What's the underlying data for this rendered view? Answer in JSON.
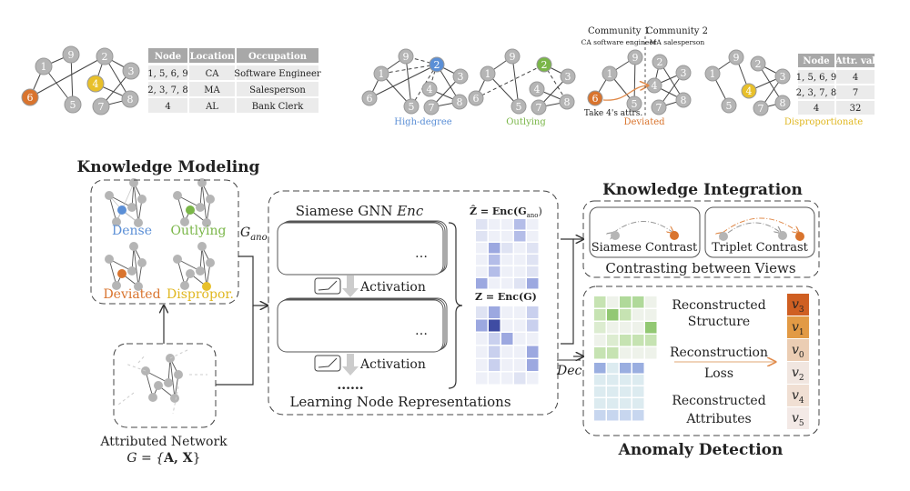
{
  "colors": {
    "gray_node": "#b5b5b5",
    "blue": "#5b8fd6",
    "green": "#7ab648",
    "orange": "#d9742e",
    "yellow": "#e8c02a",
    "purple": "#8f9ae0",
    "table_header": "#a8a8a8",
    "table_cell": "#ebebeb"
  },
  "top_left": {
    "graph_nodes": [
      "1",
      "9",
      "2",
      "3",
      "4",
      "6",
      "5",
      "7",
      "8"
    ],
    "table": {
      "headers": [
        "Node",
        "Location",
        "Occupation"
      ],
      "rows": [
        [
          "1, 5, 6, 9",
          "CA",
          "Software Engineer"
        ],
        [
          "2, 3, 7, 8",
          "MA",
          "Salesperson"
        ],
        [
          "4",
          "AL",
          "Bank Clerk"
        ]
      ]
    }
  },
  "anomaly_types": {
    "high_degree": "High-degree",
    "outlying": "Outlying",
    "deviated": "Deviated",
    "disproportionate": "Disproportionate",
    "community1_title": "Community 1",
    "community1_sub": "CA software engineer",
    "community2_title": "Community 2",
    "community2_sub": "MA salesperson",
    "take_attrs": "Take 4's attrs.",
    "attr_table": {
      "headers": [
        "Node",
        "Attr. val"
      ],
      "rows": [
        [
          "1, 5, 6, 9",
          "4"
        ],
        [
          "2, 3, 7, 8",
          "7"
        ],
        [
          "4",
          "32"
        ]
      ]
    }
  },
  "knowledge_modeling": {
    "title": "Knowledge Modeling",
    "items": [
      "Dense",
      "Outlying",
      "Deviated",
      "Dispropor."
    ],
    "g_ano": "G",
    "g_ano_sub": "ano"
  },
  "attributed_network": {
    "label": "Attributed Network",
    "formula_lhs": "G = {",
    "formula_bold": "A, X",
    "formula_rhs": "}"
  },
  "encoder": {
    "title": "Siamese GNN ",
    "title_math": "Enc",
    "activation": "Activation",
    "ellipsis": "…",
    "more": "......",
    "footer": "Learning Node Representations"
  },
  "embeddings": {
    "z_hat_label": "Ẑ = Enc(G",
    "z_hat_sub": "ano",
    "z_hat_close": ")",
    "z_label": "Z = Enc(G)",
    "z_hat": [
      [
        1,
        0,
        0,
        3,
        0
      ],
      [
        1,
        0,
        0,
        3,
        0
      ],
      [
        0,
        4,
        1,
        0,
        1
      ],
      [
        0,
        3,
        0,
        0,
        1
      ],
      [
        0,
        3,
        0,
        0,
        1
      ],
      [
        4,
        0,
        0,
        1,
        4
      ]
    ],
    "z": [
      [
        1,
        4,
        0,
        0,
        2
      ],
      [
        4,
        8,
        0,
        0,
        2
      ],
      [
        0,
        2,
        4,
        0,
        0
      ],
      [
        0,
        2,
        0,
        0,
        4
      ],
      [
        0,
        2,
        0,
        0,
        4
      ],
      [
        0,
        0,
        0,
        1,
        0
      ]
    ]
  },
  "dec_label": "Dec",
  "knowledge_integration": {
    "title": "Knowledge Integration",
    "siamese": "Siamese Contrast",
    "triplet": "Triplet Contrast",
    "footer": "Contrasting between Views"
  },
  "anomaly_detection": {
    "title": "Anomaly Detection",
    "structure": [
      "Reconstructed",
      "Structure"
    ],
    "loss": [
      "Reconstruction",
      "Loss"
    ],
    "attributes": [
      "Reconstructed",
      "Attributes"
    ],
    "structure_matrix": [
      [
        2,
        0,
        3,
        3,
        0
      ],
      [
        2,
        4,
        2,
        0,
        0
      ],
      [
        1,
        0,
        0,
        0,
        4
      ],
      [
        0,
        1,
        2,
        2,
        2
      ],
      [
        2,
        2,
        0,
        0,
        0
      ]
    ],
    "attribute_matrix": [
      [
        3,
        1,
        3,
        3
      ],
      [
        1,
        1,
        1,
        1
      ],
      [
        1,
        1,
        1,
        1
      ],
      [
        1,
        1,
        1,
        1
      ],
      [
        2,
        2,
        2,
        2
      ]
    ],
    "ranking": [
      {
        "node": "v",
        "sub": "3",
        "color": "#cf5f22"
      },
      {
        "node": "v",
        "sub": "1",
        "color": "#e29a45"
      },
      {
        "node": "v",
        "sub": "0",
        "color": "#ebcdb3"
      },
      {
        "node": "v",
        "sub": "2",
        "color": "#f1e6e0"
      },
      {
        "node": "v",
        "sub": "4",
        "color": "#f0dfd3"
      },
      {
        "node": "v",
        "sub": "5",
        "color": "#f3e9e6"
      }
    ]
  }
}
